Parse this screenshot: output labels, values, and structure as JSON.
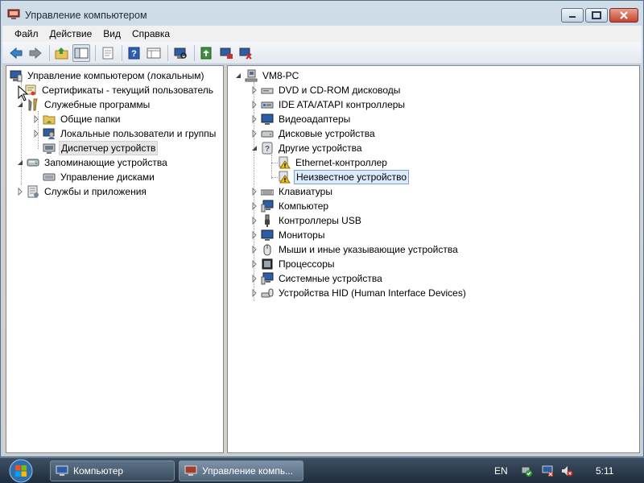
{
  "window": {
    "title": "Управление компьютером"
  },
  "menu": [
    "Файл",
    "Действие",
    "Вид",
    "Справка"
  ],
  "toolbar": {
    "icons": [
      "back-arrow-icon",
      "forward-arrow-icon",
      "up-folder-icon",
      "show-hide-tree-icon",
      "properties-icon",
      "help-icon",
      "view-icon",
      "scan-hardware-icon",
      "update-driver-icon",
      "disable-device-icon",
      "uninstall-device-icon"
    ]
  },
  "left_tree": {
    "root": "Управление компьютером (локальным)",
    "items": [
      {
        "label": "Сертификаты - текущий пользователь"
      },
      {
        "label": "Служебные программы"
      },
      {
        "label": "Общие папки"
      },
      {
        "label": "Локальные пользователи и группы"
      },
      {
        "label": "Диспетчер устройств",
        "selected": true
      },
      {
        "label": "Запоминающие устройства"
      },
      {
        "label": "Управление дисками"
      },
      {
        "label": "Службы и приложения"
      }
    ]
  },
  "right_tree": {
    "root": "VM8-PC",
    "items": [
      {
        "label": "DVD и CD-ROM дисководы"
      },
      {
        "label": "IDE ATA/ATAPI контроллеры"
      },
      {
        "label": "Видеоадаптеры"
      },
      {
        "label": "Дисковые устройства"
      },
      {
        "label": "Другие устройства",
        "expanded": true
      },
      {
        "label": "Ethernet-контроллер",
        "warning": true
      },
      {
        "label": "Неизвестное устройство",
        "warning": true,
        "selected": true
      },
      {
        "label": "Клавиатуры"
      },
      {
        "label": "Компьютер"
      },
      {
        "label": "Контроллеры USB"
      },
      {
        "label": "Мониторы"
      },
      {
        "label": "Мыши и иные указывающие устройства"
      },
      {
        "label": "Процессоры"
      },
      {
        "label": "Системные устройства"
      },
      {
        "label": "Устройства HID (Human Interface Devices)"
      }
    ]
  },
  "taskbar": {
    "tasks": [
      "Компьютер",
      "Управление компь..."
    ],
    "lang": "EN",
    "clock": "5:11"
  },
  "colors": {
    "selection_blue": "#dcebfc",
    "selection_border": "#7da2ce",
    "taskbar": "#2b3a4b",
    "warning": "#f2c400"
  }
}
